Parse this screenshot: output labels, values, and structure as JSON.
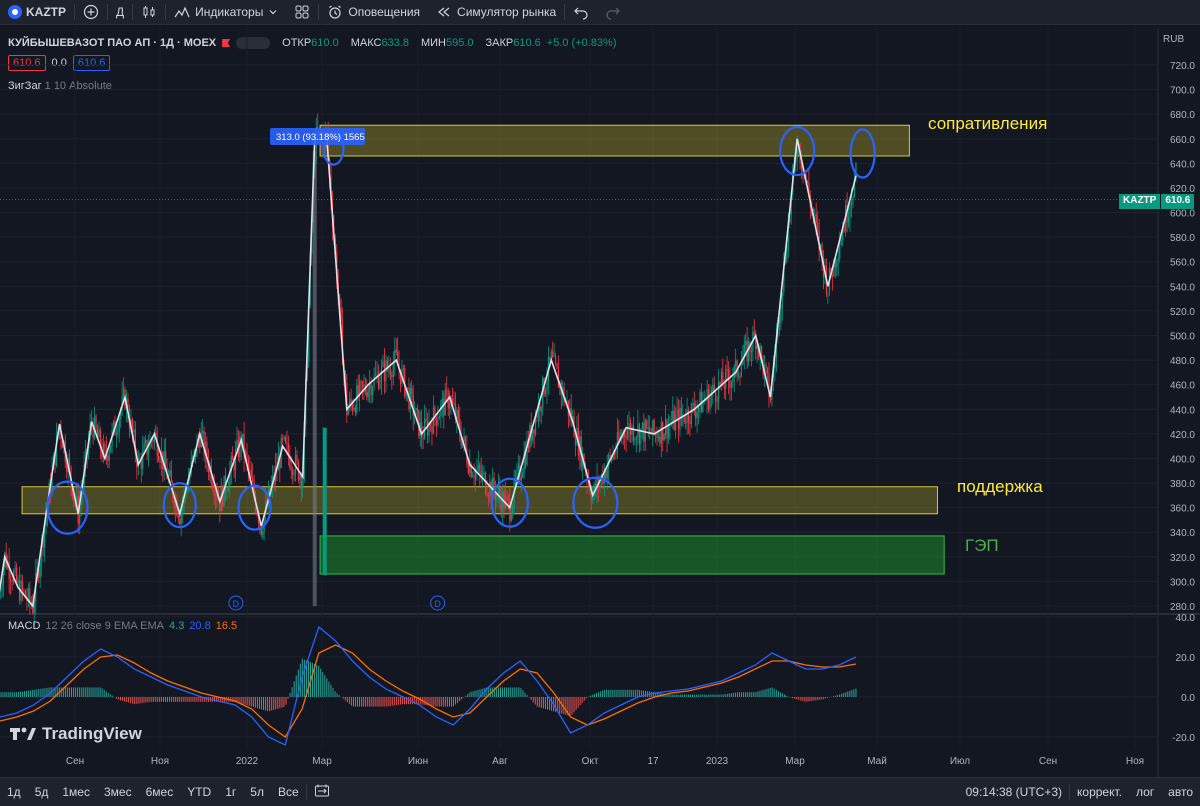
{
  "toolbar": {
    "symbol": "KAZTP",
    "interval": "Д",
    "indicators": "Индикаторы",
    "alerts": "Оповещения",
    "replay": "Симулятор рынка"
  },
  "legend": {
    "title": "КУЙБЫШЕВАЗОТ ПАО АП · 1Д · MOEX",
    "open_label": "ОТКР",
    "open": "610.0",
    "high_label": "МАКС",
    "high": "633.8",
    "low_label": "МИН",
    "low": "595.0",
    "close_label": "ЗАКР",
    "close": "610.6",
    "change": "+5.0 (+0.83%)",
    "bid": "610.6",
    "spread": "0.0",
    "ask": "610.6"
  },
  "zigzag_legend": {
    "name": "ЗигЗаг",
    "params": "1 10 Absolute"
  },
  "macd_legend": {
    "name": "MACD",
    "params": "12 26 close 9 EMA EMA",
    "hist": "4.3",
    "macd": "20.8",
    "signal": "16.5"
  },
  "currency": "RUB",
  "last_price_label": {
    "symbol": "KAZTP",
    "price": "610.6"
  },
  "brand": "TradingView",
  "annotations": {
    "resistance": "сопративления",
    "support": "поддержка",
    "gap": "ГЭП",
    "measure": "313.0 (93.18%) 1565",
    "dividend_marker": "D"
  },
  "colors": {
    "background": "#131722",
    "up": "#089981",
    "down": "#f23645",
    "zigzag": "#e0e3eb",
    "macd": "#2962ff",
    "signal": "#ff6d00",
    "resistance_zone": "#c2b32a",
    "support_zone": "#c2b32a",
    "gap_zone": "#1d8a2c",
    "annotation_text": "#ffeb3b",
    "gap_text": "#4caf50",
    "circles": "#2962ff"
  },
  "bottombar": {
    "ranges": [
      "1д",
      "5д",
      "1мес",
      "3мес",
      "6мес",
      "YTD",
      "1г",
      "5л",
      "Все"
    ],
    "time": "09:14:38 (UTC+3)",
    "adjust": "коррект.",
    "log": "лог",
    "auto": "авто"
  },
  "chart_data": [
    {
      "type": "candlestick",
      "title": "КУЙБЫШЕВАЗОТ ПАО АП · 1Д · MOEX",
      "y_ticks": [
        280,
        300,
        320,
        340,
        360,
        380,
        400,
        420,
        440,
        460,
        480,
        500,
        520,
        540,
        560,
        580,
        600,
        620,
        640,
        660,
        680,
        700,
        720
      ],
      "ylim": [
        275,
        733
      ],
      "x_ticks": [
        "Сен",
        "Ноя",
        "2022",
        "Мар",
        "Июн",
        "Авг",
        "Окт",
        "17",
        "2023",
        "Мар",
        "Май",
        "Июл",
        "Сен",
        "Ноя"
      ],
      "last_price": 610.6,
      "zigzag": [
        {
          "x": "2021-07-07",
          "y": 285
        },
        {
          "x": "2021-07-12",
          "y": 320
        },
        {
          "x": "2021-07-22",
          "y": 295
        },
        {
          "x": "2021-08-02",
          "y": 280
        },
        {
          "x": "2021-08-12",
          "y": 355
        },
        {
          "x": "2021-08-22",
          "y": 428
        },
        {
          "x": "2021-09-05",
          "y": 355
        },
        {
          "x": "2021-09-15",
          "y": 430
        },
        {
          "x": "2021-09-25",
          "y": 400
        },
        {
          "x": "2021-10-10",
          "y": 450
        },
        {
          "x": "2021-10-20",
          "y": 395
        },
        {
          "x": "2021-11-01",
          "y": 420
        },
        {
          "x": "2021-11-20",
          "y": 355
        },
        {
          "x": "2021-12-05",
          "y": 420
        },
        {
          "x": "2021-12-20",
          "y": 365
        },
        {
          "x": "2022-01-05",
          "y": 415
        },
        {
          "x": "2022-01-20",
          "y": 345
        },
        {
          "x": "2022-02-05",
          "y": 410
        },
        {
          "x": "2022-02-20",
          "y": 385
        },
        {
          "x": "2022-03-01",
          "y": 660
        },
        {
          "x": "2022-03-10",
          "y": 660
        },
        {
          "x": "2022-03-25",
          "y": 440
        },
        {
          "x": "2022-04-10",
          "y": 460
        },
        {
          "x": "2022-05-01",
          "y": 480
        },
        {
          "x": "2022-05-20",
          "y": 420
        },
        {
          "x": "2022-06-10",
          "y": 450
        },
        {
          "x": "2022-06-25",
          "y": 395
        },
        {
          "x": "2022-07-25",
          "y": 360
        },
        {
          "x": "2022-08-25",
          "y": 480
        },
        {
          "x": "2022-09-10",
          "y": 430
        },
        {
          "x": "2022-09-25",
          "y": 370
        },
        {
          "x": "2022-10-20",
          "y": 425
        },
        {
          "x": "2022-11-10",
          "y": 420
        },
        {
          "x": "2022-12-10",
          "y": 440
        },
        {
          "x": "2023-01-10",
          "y": 470
        },
        {
          "x": "2023-01-25",
          "y": 500
        },
        {
          "x": "2023-02-05",
          "y": 450
        },
        {
          "x": "2023-02-25",
          "y": 660
        },
        {
          "x": "2023-03-20",
          "y": 540
        },
        {
          "x": "2023-04-10",
          "y": 630
        }
      ],
      "zones": [
        {
          "label": "сопративления",
          "from": "2022-03-05",
          "to": "2023-05-20",
          "y0": 646,
          "y1": 671
        },
        {
          "label": "поддержка",
          "from": "2021-07-25",
          "to": "2023-06-10",
          "y0": 355,
          "y1": 377
        },
        {
          "label": "ГЭП",
          "from": "2022-03-05",
          "to": "2023-06-15",
          "y0": 306,
          "y1": 337
        }
      ],
      "dividends": [
        "2022-01-01",
        "2022-06-01"
      ]
    },
    {
      "type": "line",
      "title": "MACD 12 26 close 9 EMA EMA",
      "y_ticks": [
        -20,
        0,
        20,
        40
      ],
      "ylim": [
        -22,
        40
      ],
      "series": [
        {
          "name": "MACD",
          "values": [
            -10,
            -8,
            -4,
            2,
            10,
            18,
            24,
            20,
            14,
            10,
            6,
            3,
            0,
            -2,
            -4,
            -10,
            -20,
            -24,
            10,
            35,
            28,
            18,
            10,
            4,
            0,
            -4,
            -10,
            -14,
            -6,
            4,
            12,
            18,
            8,
            -4,
            -18,
            -14,
            -8,
            -4,
            0,
            2,
            3,
            4,
            6,
            8,
            12,
            16,
            22,
            18,
            14,
            14,
            16,
            20
          ],
          "x_step": "~week"
        },
        {
          "name": "Signal",
          "values": [
            -12,
            -10,
            -7,
            -2,
            6,
            14,
            20,
            21,
            17,
            12,
            8,
            5,
            2,
            0,
            -2,
            -6,
            -14,
            -20,
            -6,
            22,
            26,
            22,
            14,
            8,
            3,
            -1,
            -6,
            -10,
            -8,
            0,
            8,
            14,
            12,
            2,
            -10,
            -14,
            -11,
            -7,
            -3,
            0,
            2,
            3,
            5,
            7,
            10,
            14,
            18,
            18,
            16,
            15,
            15,
            16.5
          ]
        }
      ],
      "histogram_last": 4.3,
      "macd_last": 20.8,
      "signal_last": 16.5
    }
  ]
}
